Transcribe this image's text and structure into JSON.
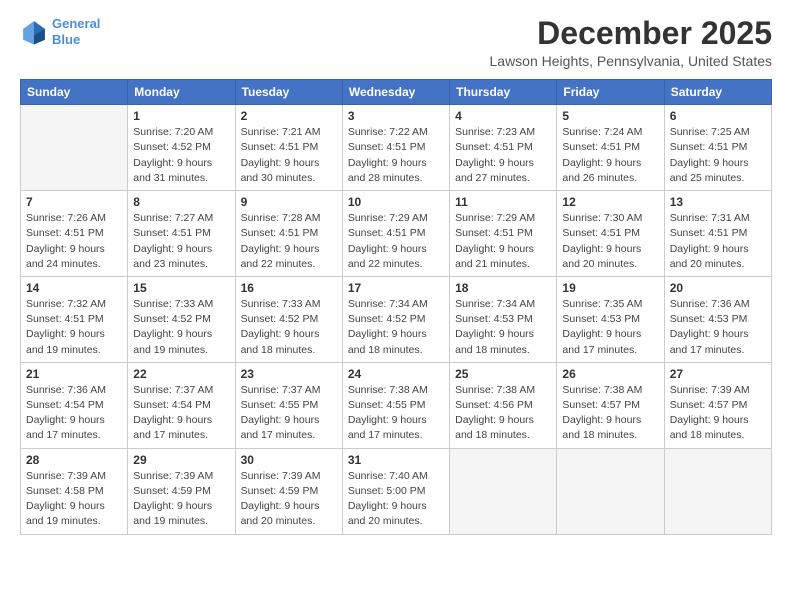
{
  "logo": {
    "line1": "General",
    "line2": "Blue"
  },
  "title": "December 2025",
  "subtitle": "Lawson Heights, Pennsylvania, United States",
  "days_of_week": [
    "Sunday",
    "Monday",
    "Tuesday",
    "Wednesday",
    "Thursday",
    "Friday",
    "Saturday"
  ],
  "weeks": [
    [
      {
        "day": "",
        "info": ""
      },
      {
        "day": "1",
        "info": "Sunrise: 7:20 AM\nSunset: 4:52 PM\nDaylight: 9 hours\nand 31 minutes."
      },
      {
        "day": "2",
        "info": "Sunrise: 7:21 AM\nSunset: 4:51 PM\nDaylight: 9 hours\nand 30 minutes."
      },
      {
        "day": "3",
        "info": "Sunrise: 7:22 AM\nSunset: 4:51 PM\nDaylight: 9 hours\nand 28 minutes."
      },
      {
        "day": "4",
        "info": "Sunrise: 7:23 AM\nSunset: 4:51 PM\nDaylight: 9 hours\nand 27 minutes."
      },
      {
        "day": "5",
        "info": "Sunrise: 7:24 AM\nSunset: 4:51 PM\nDaylight: 9 hours\nand 26 minutes."
      },
      {
        "day": "6",
        "info": "Sunrise: 7:25 AM\nSunset: 4:51 PM\nDaylight: 9 hours\nand 25 minutes."
      }
    ],
    [
      {
        "day": "7",
        "info": "Sunrise: 7:26 AM\nSunset: 4:51 PM\nDaylight: 9 hours\nand 24 minutes."
      },
      {
        "day": "8",
        "info": "Sunrise: 7:27 AM\nSunset: 4:51 PM\nDaylight: 9 hours\nand 23 minutes."
      },
      {
        "day": "9",
        "info": "Sunrise: 7:28 AM\nSunset: 4:51 PM\nDaylight: 9 hours\nand 22 minutes."
      },
      {
        "day": "10",
        "info": "Sunrise: 7:29 AM\nSunset: 4:51 PM\nDaylight: 9 hours\nand 22 minutes."
      },
      {
        "day": "11",
        "info": "Sunrise: 7:29 AM\nSunset: 4:51 PM\nDaylight: 9 hours\nand 21 minutes."
      },
      {
        "day": "12",
        "info": "Sunrise: 7:30 AM\nSunset: 4:51 PM\nDaylight: 9 hours\nand 20 minutes."
      },
      {
        "day": "13",
        "info": "Sunrise: 7:31 AM\nSunset: 4:51 PM\nDaylight: 9 hours\nand 20 minutes."
      }
    ],
    [
      {
        "day": "14",
        "info": "Sunrise: 7:32 AM\nSunset: 4:51 PM\nDaylight: 9 hours\nand 19 minutes."
      },
      {
        "day": "15",
        "info": "Sunrise: 7:33 AM\nSunset: 4:52 PM\nDaylight: 9 hours\nand 19 minutes."
      },
      {
        "day": "16",
        "info": "Sunrise: 7:33 AM\nSunset: 4:52 PM\nDaylight: 9 hours\nand 18 minutes."
      },
      {
        "day": "17",
        "info": "Sunrise: 7:34 AM\nSunset: 4:52 PM\nDaylight: 9 hours\nand 18 minutes."
      },
      {
        "day": "18",
        "info": "Sunrise: 7:34 AM\nSunset: 4:53 PM\nDaylight: 9 hours\nand 18 minutes."
      },
      {
        "day": "19",
        "info": "Sunrise: 7:35 AM\nSunset: 4:53 PM\nDaylight: 9 hours\nand 17 minutes."
      },
      {
        "day": "20",
        "info": "Sunrise: 7:36 AM\nSunset: 4:53 PM\nDaylight: 9 hours\nand 17 minutes."
      }
    ],
    [
      {
        "day": "21",
        "info": "Sunrise: 7:36 AM\nSunset: 4:54 PM\nDaylight: 9 hours\nand 17 minutes."
      },
      {
        "day": "22",
        "info": "Sunrise: 7:37 AM\nSunset: 4:54 PM\nDaylight: 9 hours\nand 17 minutes."
      },
      {
        "day": "23",
        "info": "Sunrise: 7:37 AM\nSunset: 4:55 PM\nDaylight: 9 hours\nand 17 minutes."
      },
      {
        "day": "24",
        "info": "Sunrise: 7:38 AM\nSunset: 4:55 PM\nDaylight: 9 hours\nand 17 minutes."
      },
      {
        "day": "25",
        "info": "Sunrise: 7:38 AM\nSunset: 4:56 PM\nDaylight: 9 hours\nand 18 minutes."
      },
      {
        "day": "26",
        "info": "Sunrise: 7:38 AM\nSunset: 4:57 PM\nDaylight: 9 hours\nand 18 minutes."
      },
      {
        "day": "27",
        "info": "Sunrise: 7:39 AM\nSunset: 4:57 PM\nDaylight: 9 hours\nand 18 minutes."
      }
    ],
    [
      {
        "day": "28",
        "info": "Sunrise: 7:39 AM\nSunset: 4:58 PM\nDaylight: 9 hours\nand 19 minutes."
      },
      {
        "day": "29",
        "info": "Sunrise: 7:39 AM\nSunset: 4:59 PM\nDaylight: 9 hours\nand 19 minutes."
      },
      {
        "day": "30",
        "info": "Sunrise: 7:39 AM\nSunset: 4:59 PM\nDaylight: 9 hours\nand 20 minutes."
      },
      {
        "day": "31",
        "info": "Sunrise: 7:40 AM\nSunset: 5:00 PM\nDaylight: 9 hours\nand 20 minutes."
      },
      {
        "day": "",
        "info": ""
      },
      {
        "day": "",
        "info": ""
      },
      {
        "day": "",
        "info": ""
      }
    ]
  ]
}
